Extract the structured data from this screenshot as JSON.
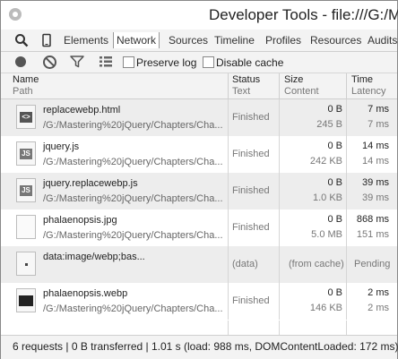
{
  "window": {
    "title": "Developer Tools - file:///G:/Mas"
  },
  "panel_tabs": {
    "items": [
      "Elements",
      "Network",
      "Sources",
      "Timeline",
      "Profiles",
      "Resources",
      "Audits"
    ],
    "active": "Network",
    "icons": [
      "search-icon",
      "device-icon"
    ]
  },
  "toolbar": {
    "preserve_log": {
      "label": "Preserve log",
      "checked": false
    },
    "disable_cache": {
      "label": "Disable cache",
      "checked": false
    },
    "icons": [
      "record-icon",
      "clear-icon",
      "filter-icon",
      "view-icon"
    ]
  },
  "header": {
    "name": {
      "top": "Name",
      "sub": "Path"
    },
    "status": {
      "top": "Status",
      "sub": "Text"
    },
    "size": {
      "top": "Size",
      "sub": "Content"
    },
    "time": {
      "top": "Time",
      "sub": "Latency"
    }
  },
  "requests": [
    {
      "icon": "html-file-icon",
      "icon_text": "<>",
      "name": "replacewebp.html",
      "path": "/G:/Mastering%20jQuery/Chapters/Cha...",
      "status": "Finished",
      "size": "0 B",
      "content": "245 B",
      "time": "7 ms",
      "latency": "7 ms"
    },
    {
      "icon": "js-file-icon",
      "icon_text": "JS",
      "name": "jquery.js",
      "path": "/G:/Mastering%20jQuery/Chapters/Cha...",
      "status": "Finished",
      "size": "0 B",
      "content": "242 KB",
      "time": "14 ms",
      "latency": "14 ms"
    },
    {
      "icon": "js-file-icon",
      "icon_text": "JS",
      "name": "jquery.replacewebp.js",
      "path": "/G:/Mastering%20jQuery/Chapters/Cha...",
      "status": "Finished",
      "size": "0 B",
      "content": "1.0 KB",
      "time": "39 ms",
      "latency": "39 ms"
    },
    {
      "icon": "image-file-icon",
      "icon_text": "",
      "name": "phalaenopsis.jpg",
      "path": "/G:/Mastering%20jQuery/Chapters/Cha...",
      "status": "Finished",
      "size": "0 B",
      "content": "5.0 MB",
      "time": "868 ms",
      "latency": "151 ms"
    },
    {
      "icon": "data-uri-icon",
      "icon_text": "",
      "name": "data:image/webp;bas...",
      "path": "",
      "status": "(data)",
      "size": "(from cache)",
      "content": "",
      "time": "Pending",
      "latency": ""
    },
    {
      "icon": "webp-image-icon",
      "icon_text": "",
      "name": "phalaenopsis.webp",
      "path": "/G:/Mastering%20jQuery/Chapters/Cha...",
      "status": "Finished",
      "size": "0 B",
      "content": "146 KB",
      "time": "2 ms",
      "latency": "2 ms"
    }
  ],
  "footer": {
    "summary": "6 requests | 0 B transferred | 1.01 s (load: 988 ms, DOMContentLoaded: 172 ms)"
  }
}
